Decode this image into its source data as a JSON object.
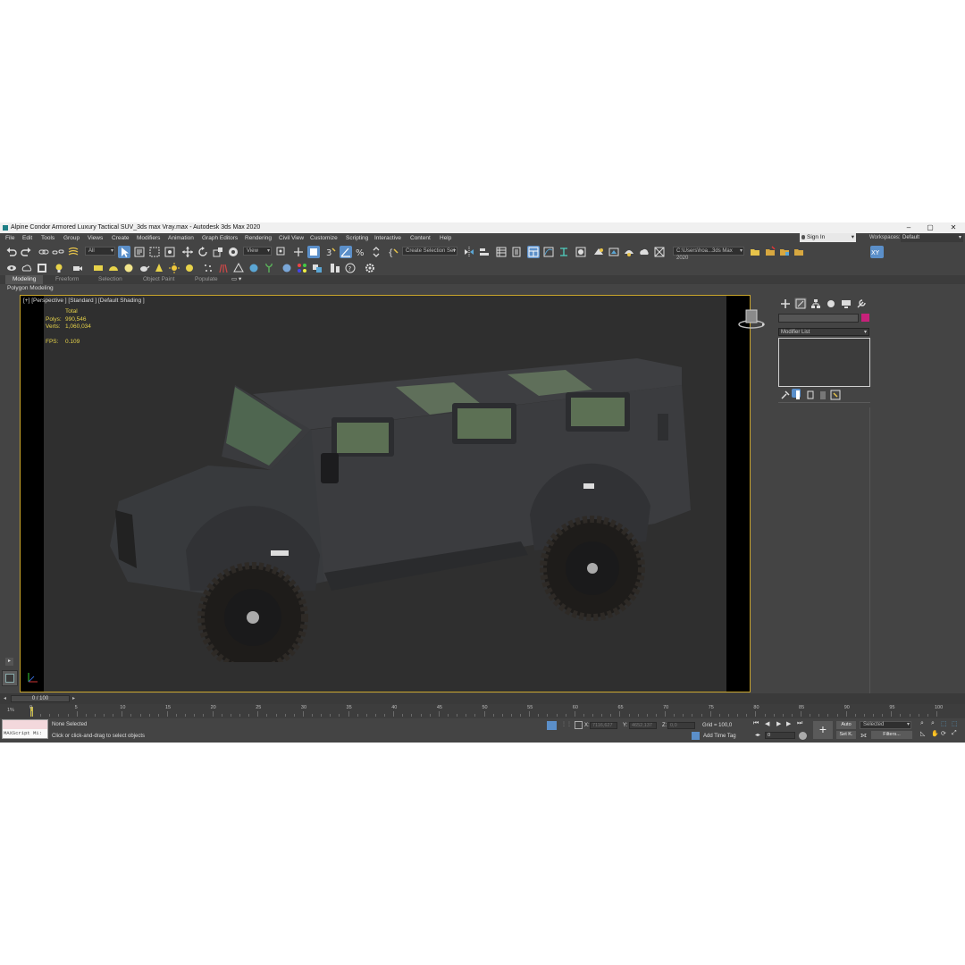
{
  "window": {
    "title": "Alpine Condor Armored Luxury Tactical SUV_3ds max Vray.max - Autodesk 3ds Max 2020",
    "controls": {
      "minimize": "–",
      "maximize": "▢",
      "close": "✕"
    }
  },
  "menu": {
    "items": [
      "File",
      "Edit",
      "Tools",
      "Group",
      "Views",
      "Create",
      "Modifiers",
      "Animation",
      "Graph Editors",
      "Rendering",
      "Civil View",
      "Customize",
      "Scripting",
      "Interactive",
      "Content",
      "Help"
    ],
    "sign_in": "Sign In",
    "workspaces_label": "Workspaces:",
    "workspaces_value": "Default"
  },
  "toolbar": {
    "selection_filter": "All",
    "ref_coord": "View",
    "selection_set": "Create Selection Set",
    "project_path": "C:\\Users\\hoa...3ds Max 2020",
    "axis_buttons": [
      "X",
      "Y",
      "Z",
      "XY"
    ]
  },
  "ribbon": {
    "tabs": [
      "Modeling",
      "Freeform",
      "Selection",
      "Object Paint",
      "Populate"
    ],
    "active_tab": "Modeling",
    "panel_label": "Polygon Modeling"
  },
  "viewport": {
    "label": "[+] [Perspective ] [Standard ] [Default Shading ]",
    "stats": {
      "total_label": "Total",
      "polys_label": "Polys:",
      "polys_value": "990,546",
      "verts_label": "Verts:",
      "verts_value": "1,060,034",
      "fps_label": "FPS:",
      "fps_value": "0.109"
    }
  },
  "command_panel": {
    "modifier_list": "Modifier List",
    "color_swatch": "#c7217a"
  },
  "timeline": {
    "slider": "0 / 100",
    "ticks": [
      "0",
      "5",
      "10",
      "15",
      "20",
      "25",
      "30",
      "35",
      "40",
      "45",
      "50",
      "55",
      "60",
      "65",
      "70",
      "75",
      "80",
      "85",
      "90",
      "95",
      "100"
    ]
  },
  "status": {
    "maxscript_label": "MAXScript Mi:",
    "selection": "None Selected",
    "prompt": "Click or click-and-drag to select objects",
    "x_label": "X:",
    "x_value": "7116,627",
    "y_label": "Y:",
    "y_value": "4652,137",
    "z_label": "Z:",
    "z_value": "0,0",
    "grid": "Grid = 100,0",
    "add_time_tag": "Add Time Tag",
    "auto": "Auto",
    "selected": "Selected",
    "set_key": "Set K.",
    "filters": "Filters...",
    "frame": "0"
  }
}
